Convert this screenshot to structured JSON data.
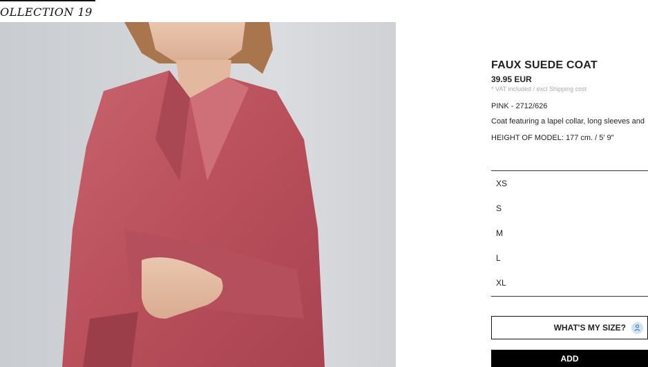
{
  "header": {
    "collection_label": "OLLECTION 19"
  },
  "product": {
    "title": "FAUX SUEDE COAT",
    "price": "39.95 EUR",
    "vat_note": "* VAT included / excl Shipping cost",
    "color_ref": "PINK - 2712/626",
    "description": "Coat featuring a lapel collar, long sleeves and",
    "model_height": "HEIGHT OF MODEL: 177 cm. / 5' 9\""
  },
  "sizes": [
    "XS",
    "S",
    "M",
    "L",
    "XL"
  ],
  "buttons": {
    "whats_my_size": "WHAT'S MY SIZE?",
    "whats_my_size_icon": "person-icon",
    "add": "ADD"
  },
  "colors": {
    "coat": "#c05a64",
    "background": "#d4d6d9",
    "add_button": "#000000",
    "size_icon_bg": "#cfe2f6"
  }
}
